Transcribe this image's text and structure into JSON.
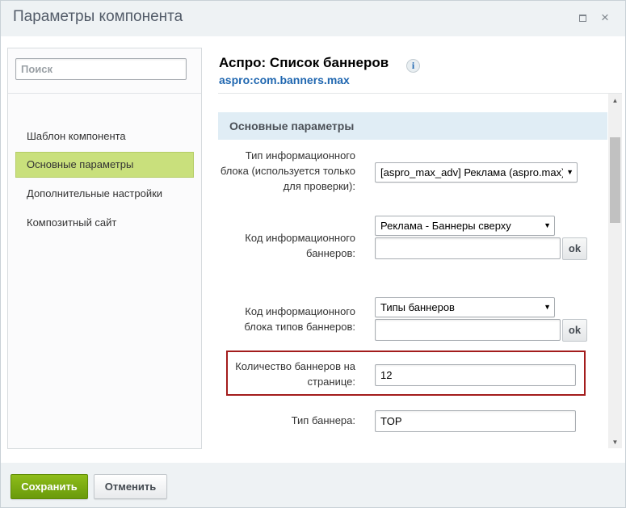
{
  "window": {
    "title": "Параметры компонента",
    "close_glyph": "×"
  },
  "sidebar": {
    "search_placeholder": "Поиск",
    "items": [
      {
        "label": "Шаблон компонента"
      },
      {
        "label": "Основные параметры",
        "active": true
      },
      {
        "label": "Дополнительные настройки"
      },
      {
        "label": "Композитный сайт"
      }
    ]
  },
  "component": {
    "title": "Аспро: Список баннеров",
    "info_glyph": "i",
    "code": "aspro:com.banners.max"
  },
  "section": {
    "title": "Основные параметры"
  },
  "fields": {
    "iblock_type": {
      "label": "Тип информационного блока (используется только для проверки):",
      "value": "[aspro_max_adv] Реклама (aspro.max)"
    },
    "iblock_code": {
      "label": "Код информационного баннеров:",
      "select_value": "Реклама - Баннеры сверху",
      "input_value": "",
      "ok_label": "ok"
    },
    "types_iblock_code": {
      "label": "Код информационного блока типов баннеров:",
      "select_value": "Типы баннеров",
      "input_value": "",
      "ok_label": "ok"
    },
    "banners_count": {
      "label": "Количество баннеров на странице:",
      "value": "12"
    },
    "banner_type": {
      "label": "Тип баннера:",
      "value": "TOP"
    }
  },
  "footer": {
    "save_label": "Сохранить",
    "cancel_label": "Отменить"
  },
  "colors": {
    "accent_green": "#7aab10",
    "link_blue": "#2067b0",
    "active_item": "#c9e07c",
    "highlight_border": "#a31c1c",
    "section_header_bg": "#e0edf5"
  },
  "icons": {
    "maximize": "maximize-icon",
    "close": "close-icon",
    "info": "info-icon",
    "dropdown": "chevron-down-icon"
  }
}
